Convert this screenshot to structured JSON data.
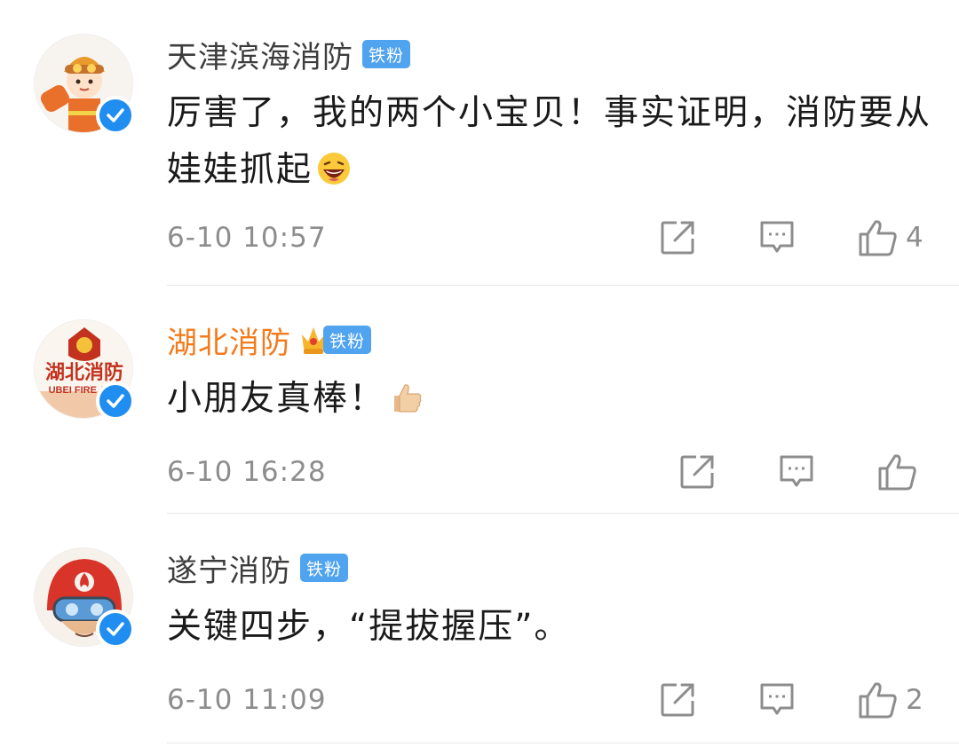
{
  "comments": [
    {
      "user": "天津滨海消防",
      "badge": "铁粉",
      "text": "厉害了，我的两个小宝贝！事实证明，消防要从娃娃抓起",
      "emoji": "laughing-face",
      "time": "6-10 10:57",
      "likes": "4"
    },
    {
      "user": "湖北消防",
      "badge": "铁粉",
      "text": "小朋友真棒！",
      "emoji": "thumbs-up",
      "time": "6-10 16:28",
      "likes": "",
      "avatar_text": "湖北消防",
      "avatar_sub": "UBEI FIRE AND"
    },
    {
      "user": "遂宁消防",
      "badge": "铁粉",
      "text": "关键四步，“提拔握压”。",
      "time": "6-10 11:09",
      "likes": "2"
    }
  ],
  "colors": {
    "verified": "#1f8ef0",
    "badge": "#4fa3ef",
    "vip_name": "#f57a1a",
    "meta": "#8d8d8d"
  },
  "icons": [
    "verified-icon",
    "repost-icon",
    "comment-icon",
    "like-icon",
    "crown-icon"
  ]
}
